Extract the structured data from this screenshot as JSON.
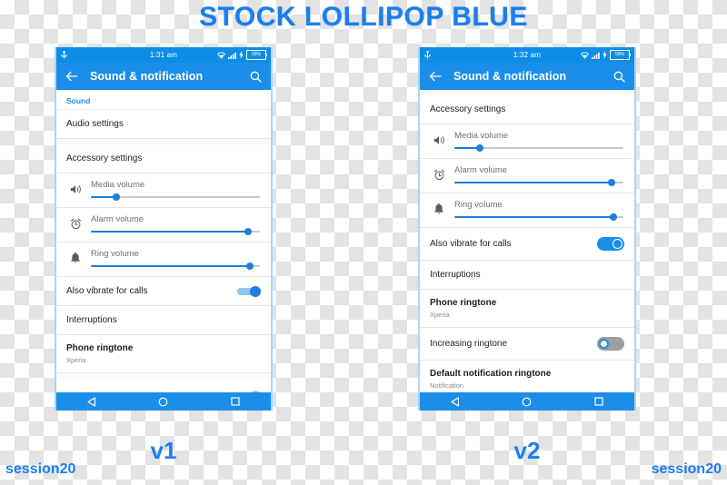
{
  "title": "STOCK LOLLIPOP BLUE",
  "colors": {
    "accent": "#1b7ef0",
    "status_bar": "#0e8de6",
    "action_bar": "#1a8ee8",
    "slider": "#1b7fe0",
    "section_header": "#1b8ee8"
  },
  "captions": {
    "v1": "v1",
    "v2": "v2",
    "watermark_left": "session20",
    "watermark_right": "session20"
  },
  "phones": {
    "v1": {
      "status": {
        "usb_icon": "usb-icon",
        "clock": "1:31 am",
        "wifi_icon": "wifi-icon",
        "signal_icon": "signal-bars-icon",
        "charging_icon": "charging-bolt-icon",
        "battery": "58%"
      },
      "appbar": {
        "back_icon": "back-arrow-icon",
        "title": "Sound & notification",
        "search_icon": "search-icon"
      },
      "rows": [
        {
          "kind": "section",
          "label": "Sound"
        },
        {
          "kind": "simple",
          "label": "Audio settings"
        },
        {
          "kind": "simple",
          "label": "Accessory settings"
        },
        {
          "kind": "slider",
          "icon": "speaker-icon",
          "label": "Media volume",
          "value": 15
        },
        {
          "kind": "slider",
          "icon": "alarm-clock-icon",
          "label": "Alarm volume",
          "value": 93
        },
        {
          "kind": "slider",
          "icon": "bell-icon",
          "label": "Ring volume",
          "value": 94
        },
        {
          "kind": "switch",
          "label": "Also vibrate for calls",
          "state": "on"
        },
        {
          "kind": "simple",
          "label": "Interruptions"
        },
        {
          "kind": "two-line",
          "label": "Phone ringtone",
          "sub": "Xperia"
        }
      ],
      "nav": {
        "back_icon": "nav-back-triangle-icon",
        "home_icon": "nav-home-circle-icon",
        "recents_icon": "nav-recents-square-icon"
      }
    },
    "v2": {
      "status": {
        "usb_icon": "usb-icon",
        "clock": "1:32 am",
        "wifi_icon": "wifi-icon",
        "signal_icon": "signal-bars-icon",
        "charging_icon": "charging-bolt-icon",
        "battery": "58%"
      },
      "appbar": {
        "back_icon": "back-arrow-icon",
        "title": "Sound & notification",
        "search_icon": "search-icon"
      },
      "rows": [
        {
          "kind": "simple",
          "label": "Accessory settings"
        },
        {
          "kind": "slider",
          "icon": "speaker-icon",
          "label": "Media volume",
          "value": 15
        },
        {
          "kind": "slider",
          "icon": "alarm-clock-icon",
          "label": "Alarm volume",
          "value": 93
        },
        {
          "kind": "slider",
          "icon": "bell-icon",
          "label": "Ring volume",
          "value": 94
        },
        {
          "kind": "switch",
          "label": "Also vibrate for calls",
          "state": "on"
        },
        {
          "kind": "simple",
          "label": "Interruptions"
        },
        {
          "kind": "two-line",
          "label": "Phone ringtone",
          "sub": "Xperia"
        },
        {
          "kind": "switch",
          "label": "Increasing ringtone",
          "state": "off"
        },
        {
          "kind": "two-line",
          "label": "Default notification ringtone",
          "sub": "Notification"
        }
      ],
      "nav": {
        "back_icon": "nav-back-triangle-icon",
        "home_icon": "nav-home-circle-icon",
        "recents_icon": "nav-recents-square-icon"
      }
    }
  }
}
